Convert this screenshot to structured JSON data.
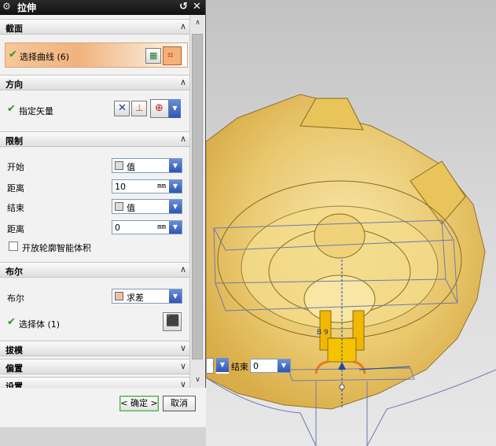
{
  "dialog": {
    "title": "拉伸",
    "title_buttons": [
      "↺",
      "✕"
    ]
  },
  "sections": {
    "section": {
      "title": "截面",
      "select_curve_label": "选择曲线 (6)"
    },
    "direction": {
      "title": "方向",
      "vector_label": "指定矢量"
    },
    "limits": {
      "title": "限制",
      "start_label": "开始",
      "start_value": "值",
      "start_distance_label": "距离",
      "start_distance_value": "10",
      "end_label": "结束",
      "end_value": "值",
      "end_distance_label": "距离",
      "end_distance_value": "0",
      "unit": "mm",
      "open_profile_label": "开放轮廓智能体积"
    },
    "boolean": {
      "title": "布尔",
      "bool_label": "布尔",
      "bool_value": "求差",
      "select_body_label": "选择体 (1)"
    },
    "draft": {
      "title": "拔模"
    },
    "offset": {
      "title": "偏置"
    },
    "settings": {
      "title": "设置"
    }
  },
  "footer": {
    "ok_label": "< 确定 >",
    "cancel_label": "取消"
  },
  "viewport": {
    "handle_label": "结束",
    "handle_value": "0",
    "dimension_label": "B 9"
  },
  "colors": {
    "accent_orange": "#f4b27a",
    "model_yellow": "#e8c45a",
    "check_green": "#2a9a10",
    "dropdown_blue": "#2e55b8"
  }
}
